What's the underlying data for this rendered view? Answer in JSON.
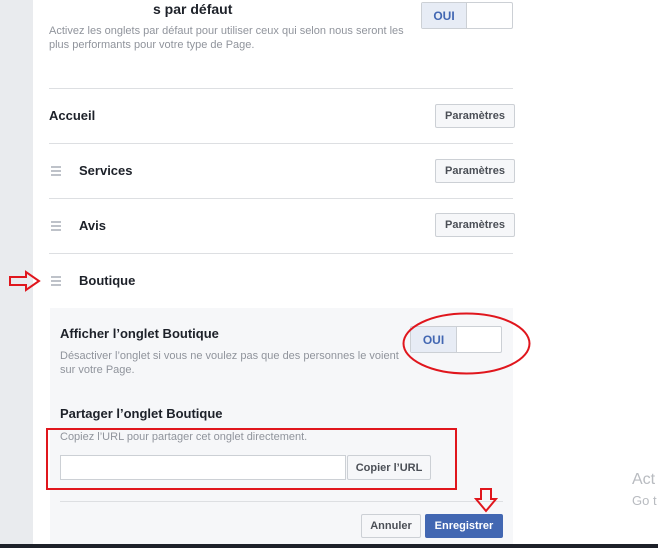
{
  "default_tabs": {
    "title": "s par défaut",
    "description": "Activez les onglets par défaut pour utiliser ceux qui selon nous seront les plus performants pour votre type de Page.",
    "toggle_label": "OUI"
  },
  "tabs": [
    {
      "label": "Accueil",
      "button": "Paramètres"
    },
    {
      "label": "Services",
      "button": "Paramètres"
    },
    {
      "label": "Avis",
      "button": "Paramètres"
    },
    {
      "label": "Boutique"
    }
  ],
  "shop": {
    "show_title": "Afficher l’onglet Boutique",
    "show_description": "Désactiver l’onglet si vous ne voulez pas que des personnes le voient sur votre Page.",
    "toggle_label": "OUI",
    "share_title": "Partager l’onglet Boutique",
    "share_description": "Copiez l’URL pour partager cet onglet directement.",
    "url_value": "",
    "copy_button": "Copier l’URL"
  },
  "footer": {
    "cancel": "Annuler",
    "save": "Enregistrer"
  },
  "watermark": {
    "line1": "Act",
    "line2": "Go t"
  },
  "colors": {
    "annotation_red": "#e0161d",
    "primary_blue": "#4267b2"
  }
}
